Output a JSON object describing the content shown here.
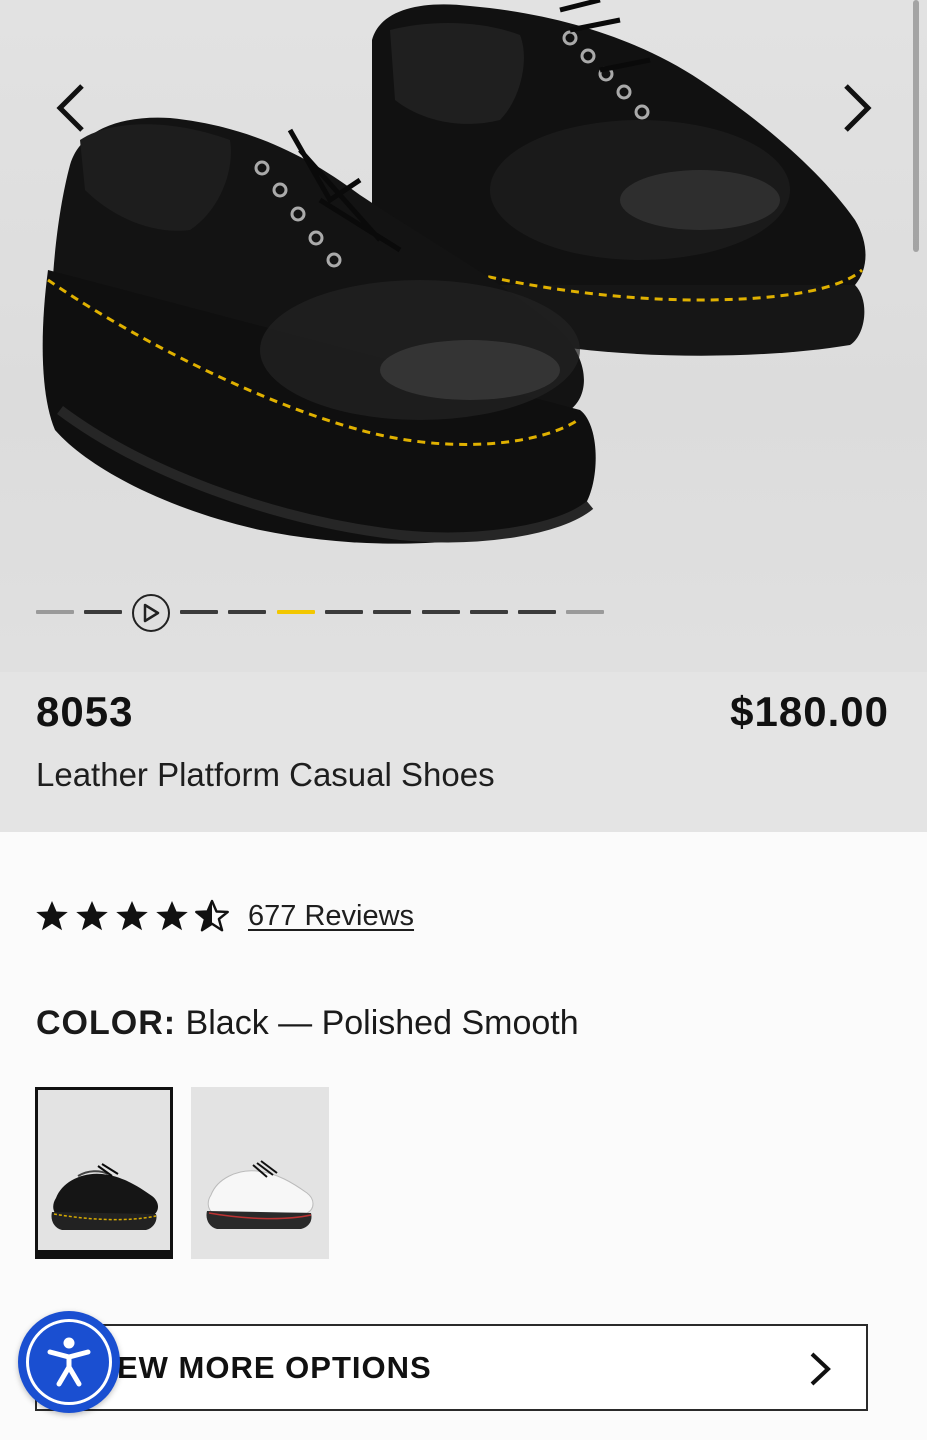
{
  "product": {
    "sku": "8053",
    "price": "$180.00",
    "name": "Leather Platform Casual Shoes"
  },
  "gallery": {
    "image_count": 12,
    "active_index": 5,
    "has_video": true,
    "accent_color": "#f2c700"
  },
  "rating": {
    "stars": 4.5,
    "reviews_label": "677 Reviews"
  },
  "color": {
    "label": "COLOR:",
    "value": "Black — Polished Smooth",
    "swatches": [
      "black-polished-smooth",
      "white-polished-smooth"
    ],
    "selected_index": 0
  },
  "options_button": {
    "label": "EW MORE OPTIONS"
  },
  "accessibility": {
    "icon": "accessibility-icon",
    "color": "#1a4fd1"
  }
}
